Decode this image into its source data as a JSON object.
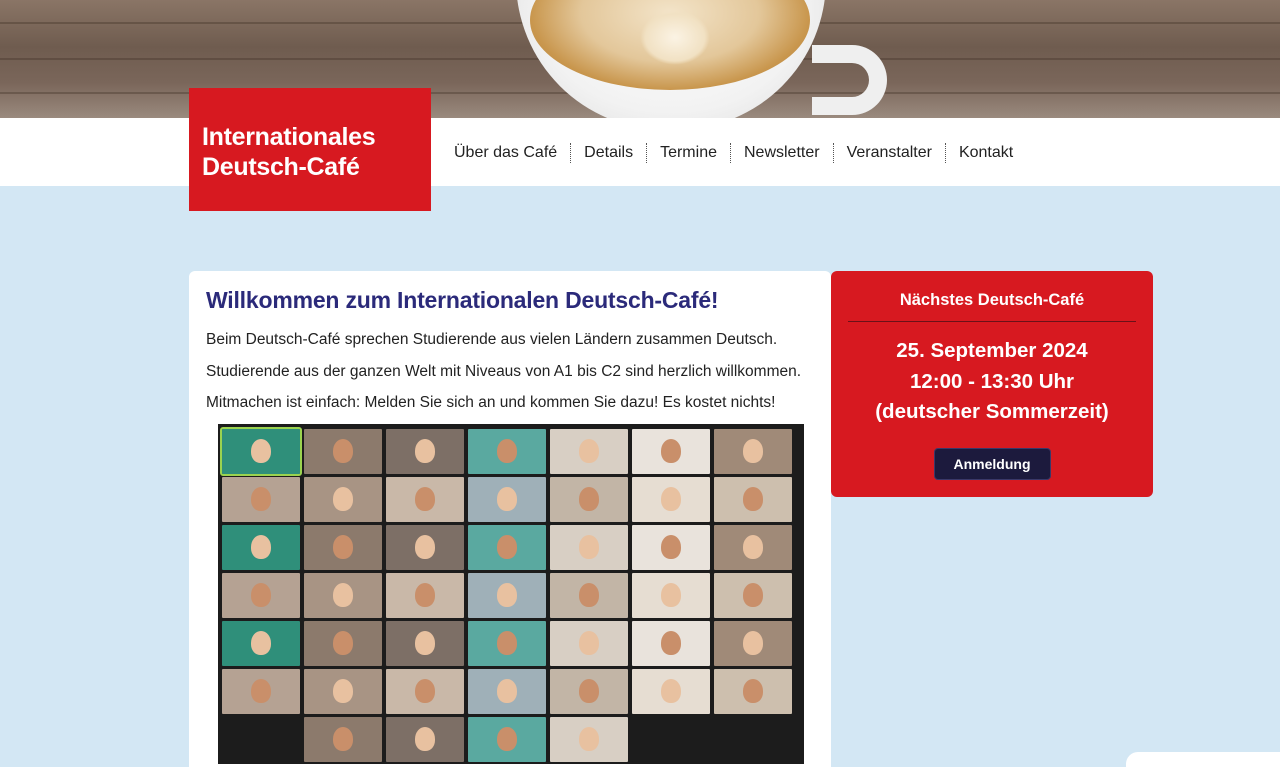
{
  "site": {
    "logo_line1": "Internationales",
    "logo_line2": "Deutsch-Café"
  },
  "nav": {
    "items": [
      "Über das Café",
      "Details",
      "Termine",
      "Newsletter",
      "Veranstalter",
      "Kontakt"
    ]
  },
  "main": {
    "heading": "Willkommen zum Internationalen Deutsch-Café!",
    "paragraphs": [
      "Beim Deutsch-Café sprechen Studierende aus vielen Ländern zusammen Deutsch.",
      "Studierende aus der ganzen Welt mit Niveaus von A1 bis C2 sind herzlich willkommen.",
      "Mitmachen ist einfach: Melden Sie sich an und kommen Sie dazu! Es kostet nichts!"
    ]
  },
  "event": {
    "title": "Nächstes Deutsch-Café",
    "date": "25. September 2024",
    "time": "12:00 - 13:30 Uhr",
    "timezone": "(deutscher Sommerzeit)",
    "button_label": "Anmeldung"
  },
  "colors": {
    "brand_red": "#d71920",
    "heading_navy": "#2b2a7a",
    "page_bg": "#d3e7f4",
    "button_dark": "#1c1a3d"
  }
}
